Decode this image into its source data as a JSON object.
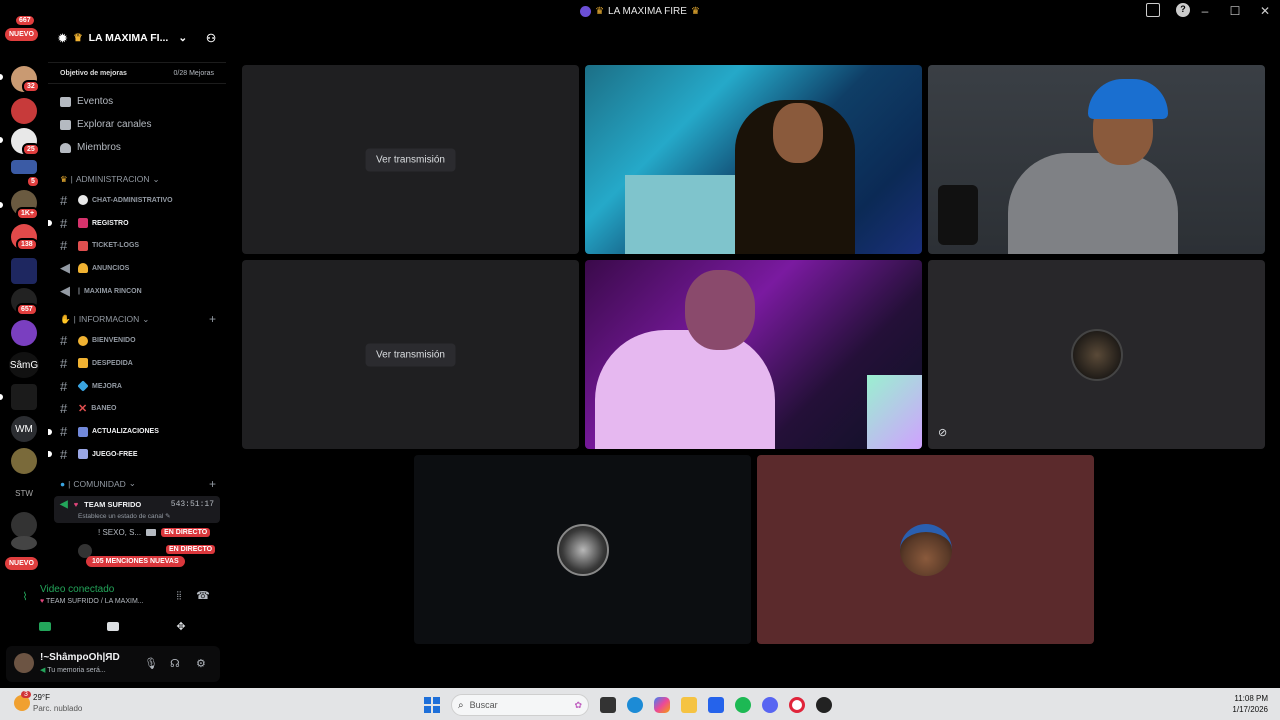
{
  "window": {
    "title": "LA MAXIMA FIRE"
  },
  "rail": {
    "nuevo_top": "NUEVO",
    "nuevo_bottom": "NUEVO",
    "top_count": "667",
    "badges": [
      "32",
      "25",
      "5",
      "1K+",
      "138",
      "657"
    ],
    "text_servers": [
      "SâmG",
      "WM",
      "STW"
    ]
  },
  "server": {
    "name": "LA MAXIMA FI...",
    "boost_label": "Objetivo de mejoras",
    "boost_count": "0/28 Mejoras"
  },
  "nav": [
    {
      "label": "Eventos"
    },
    {
      "label": "Explorar canales"
    },
    {
      "label": "Miembros"
    }
  ],
  "categories": {
    "admin": "ADMINISTRACION",
    "info": "INFORMACION",
    "comunidad": "COMUNIDAD"
  },
  "admin_channels": [
    {
      "name": "CHAT-ADMINISTRATIVO"
    },
    {
      "name": "REGISTRO"
    },
    {
      "name": "TICKET-LOGS"
    },
    {
      "name": "ANUNCIOS"
    },
    {
      "name": "MAXIMA RINCON"
    }
  ],
  "info_channels": [
    {
      "name": "BIENVENIDO"
    },
    {
      "name": "DESPEDIDA"
    },
    {
      "name": "MEJORA"
    },
    {
      "name": "BANEO"
    },
    {
      "name": "ACTUALIZACIONES"
    },
    {
      "name": "JUEGO-FREE"
    }
  ],
  "voice_channel": {
    "name": "TEAM SUFRIDO",
    "timer": "543:51:17",
    "status": "Establece un estado de canal"
  },
  "live": {
    "row_label": "! SEXO, S...",
    "tag": "EN DIRECTO",
    "tag2": "EN DIRECTO",
    "mentions": "105 MENCIONES NUEVAS"
  },
  "voice_panel": {
    "status": "Video conectado",
    "location": "TEAM SUFRIDO / LA MAXIM..."
  },
  "user": {
    "name": "!~ShâmpoOh|ЯD",
    "status": "Tu memoria será..."
  },
  "stage": {
    "watch_label_1": "Ver transmisión",
    "watch_label_2": "Ver transmisión"
  },
  "taskbar": {
    "temp": "29°F",
    "weather": "Parc. nublado",
    "weather_badge": "3",
    "search_placeholder": "Buscar",
    "time": "11:08 PM",
    "date": "1/17/2026"
  },
  "colors": {
    "accent_green": "#23a55a",
    "live_red": "#da373c",
    "tile_dark": "#1f1f21",
    "tile_maroon": "#5b2a2c"
  }
}
